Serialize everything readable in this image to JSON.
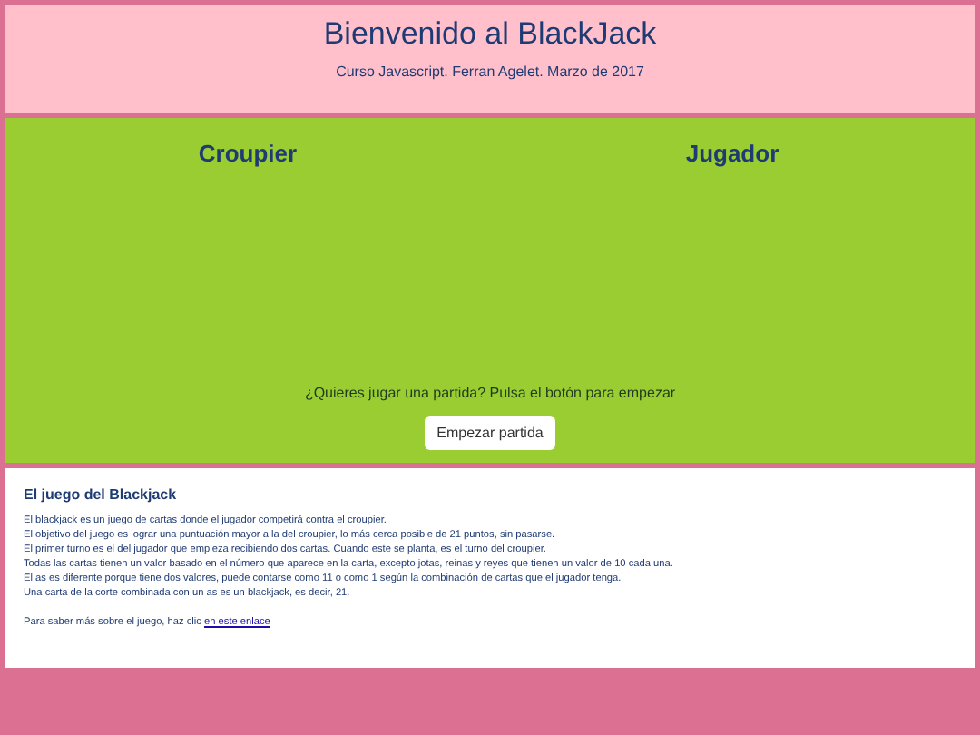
{
  "header": {
    "title": "Bienvenido al BlackJack",
    "subtitle": "Curso Javascript. Ferran Agelet. Marzo de 2017"
  },
  "game": {
    "dealer_label": "Croupier",
    "player_label": "Jugador",
    "prompt": "¿Quieres jugar una partida? Pulsa el botón para empezar",
    "start_button": "Empezar partida"
  },
  "info": {
    "heading": "El juego del Blackjack",
    "lines": [
      "El blackjack es un juego de cartas donde el jugador competirá contra el croupier.",
      "El objetivo del juego es lograr una puntuación mayor a la del croupier, lo más cerca posible de 21 puntos, sin pasarse.",
      "El primer turno es el del jugador que empieza recibiendo dos cartas. Cuando este se planta, es el turno del croupier.",
      "Todas las cartas tienen un valor basado en el número que aparece en la carta, excepto jotas, reinas y reyes que tienen un valor de 10 cada una.",
      "El as es diferente porque tiene dos valores, puede contarse como 11 o como 1 según la combinación de cartas que el jugador tenga.",
      "Una carta de la corte combinada con un as es un blackjack, es decir, 21."
    ],
    "more_text": "Para saber más sobre el juego, haz clic",
    "more_link": "en este enlace"
  }
}
